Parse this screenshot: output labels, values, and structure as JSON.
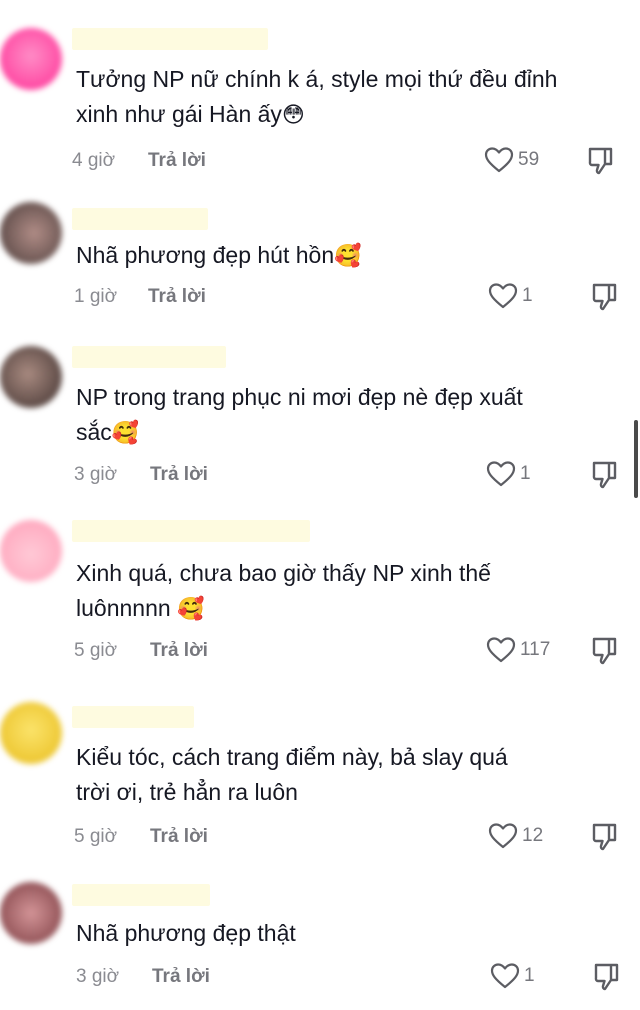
{
  "comments": [
    {
      "avatar_color": "#ff5ea8",
      "text_line1": "Tưởng NP nữ chính k á, style mọi thứ đều đỉnh",
      "text_line2": "xinh như gái Hàn ấy",
      "emoji": "😳",
      "time": "4 giờ",
      "reply": "Trả lời",
      "likes": "59"
    },
    {
      "avatar_color": "#6b5a58",
      "text_line1": "Nhã phương đẹp hút hồn",
      "text_line2": "",
      "emoji": "🥰",
      "time": "1 giờ",
      "reply": "Trả lời",
      "likes": "1"
    },
    {
      "avatar_color": "#5a4a46",
      "text_line1": "NP trong trang phục ni mơi đẹp nè đẹp xuất",
      "text_line2": "sắc",
      "emoji": "🥰",
      "time": "3 giờ",
      "reply": "Trả lời",
      "likes": "1"
    },
    {
      "avatar_color": "#ffb3c6",
      "text_line1": "Xinh quá, chưa bao giờ thấy NP xinh thế",
      "text_line2": "luônnnnn",
      "emoji": "🥰",
      "time": "5 giờ",
      "reply": "Trả lời",
      "likes": "117"
    },
    {
      "avatar_color": "#f2d23a",
      "text_line1": "Kiểu tóc, cách trang điểm này, bả slay quá",
      "text_line2": "trời ơi, trẻ hẳn ra luôn",
      "emoji": "",
      "time": "5 giờ",
      "reply": "Trả lời",
      "likes": "12"
    },
    {
      "avatar_color": "#9c5a5e",
      "text_line1": "Nhã phương đẹp thật",
      "text_line2": "",
      "emoji": "",
      "time": "3 giờ",
      "reply": "Trả lời",
      "likes": "1"
    }
  ]
}
